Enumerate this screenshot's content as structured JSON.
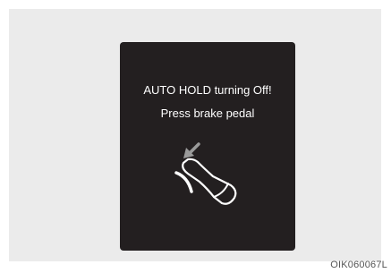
{
  "display": {
    "line1": "AUTO HOLD turning Off!",
    "line2": "Press brake pedal",
    "icon": "foot-press-brake-pedal-icon"
  },
  "figure_code": "OIK060067L",
  "colors": {
    "screen_bg": "#231f20",
    "frame_bg": "#ebebeb",
    "text": "#ffffff",
    "arrow": "#9a9a9a"
  }
}
